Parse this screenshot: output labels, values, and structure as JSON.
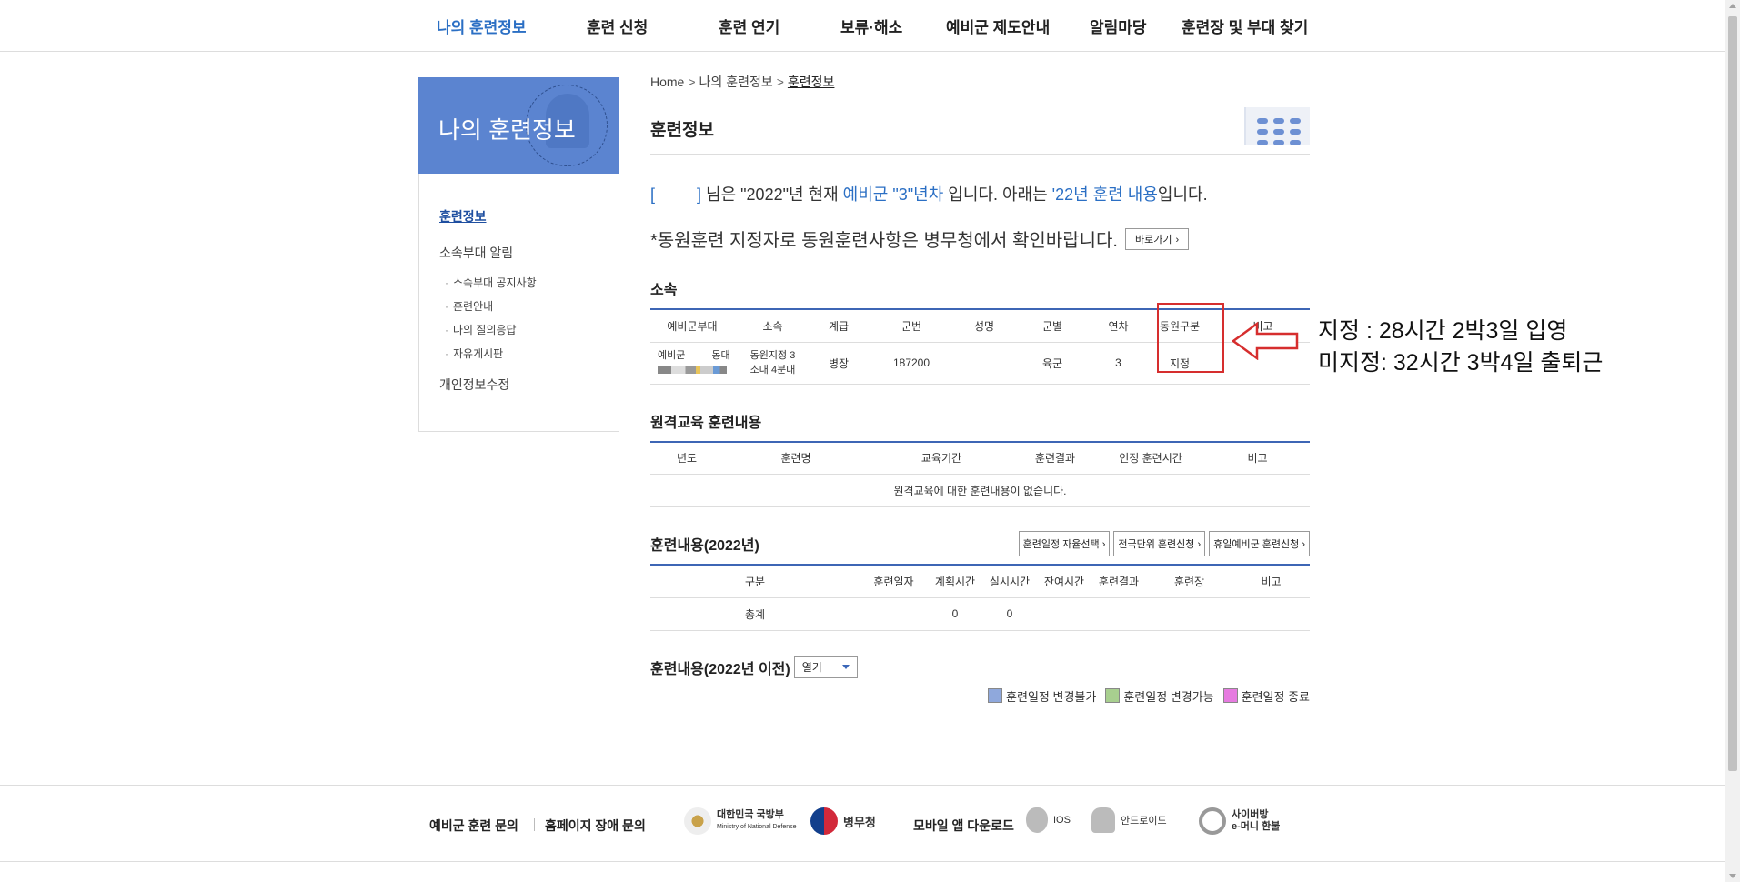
{
  "gnb": {
    "items": [
      "나의 훈련정보",
      "훈련 신청",
      "훈련 연기",
      "보류·해소",
      "예비군 제도안내",
      "알림마당",
      "훈련장 및 부대 찾기"
    ],
    "active_color": "#2b6fc4"
  },
  "lnb": {
    "title": "나의 훈련정보",
    "menu": {
      "training_info": "훈련정보",
      "unit_notice": "소속부대 알림",
      "sub": [
        "소속부대 공지사항",
        "훈련안내",
        "나의 질의응답",
        "자유게시판"
      ],
      "profile_edit": "개인정보수정"
    },
    "head_color": "#5b84d0"
  },
  "breadcrumb": {
    "home": "Home",
    "level1": "나의 훈련정보",
    "current": "훈련정보"
  },
  "page_title": "훈련정보",
  "intro": {
    "bracket_open": "[",
    "bracket_close": "]",
    "part1": " 님은 \"2022\"년 현재 ",
    "reserve": "예비군 \"3\"년차",
    "part2": " 입니다. 아래는 ",
    "year_training": "'22년 훈련 내용",
    "part3": "입니다."
  },
  "notice": {
    "text": "*동원훈련 지정자로 동원훈련사항은 병무청에서 확인바랍니다.",
    "button": "바로가기",
    "button_chevron": "›"
  },
  "affiliation": {
    "title": "소속",
    "headers": [
      "예비군부대",
      "소속",
      "계급",
      "군번",
      "성명",
      "군별",
      "연차",
      "동원구분",
      "비고"
    ],
    "row": {
      "unit_line1": "예비군",
      "unit_line2": "동대",
      "affil_line1": "동원지정 3",
      "affil_line2": "소대 4분대",
      "rank": "병장",
      "service_no": "187200",
      "name": "",
      "branch": "육군",
      "year": "3",
      "mobilization": "지정",
      "note": ""
    }
  },
  "annotation": {
    "line1": "지정 : 28시간 2박3일 입영",
    "line2": "미지정: 32시간 3박4일 출퇴근"
  },
  "remote": {
    "title": "원격교육 훈련내용",
    "headers": [
      "년도",
      "훈련명",
      "교육기간",
      "훈련결과",
      "인정 훈련시간",
      "비고"
    ],
    "empty_message": "원격교육에 대한 훈련내용이 없습니다."
  },
  "training": {
    "title": "훈련내용(2022년)",
    "buttons": [
      "훈련일정 자율선택 ›",
      "전국단위 훈련신청 ›",
      "휴일예비군 훈련신청 ›"
    ],
    "headers": [
      "구분",
      "훈련일자",
      "계획시간",
      "실시시간",
      "잔여시간",
      "훈련결과",
      "훈련장",
      "비고"
    ],
    "total_row": {
      "label": "총계",
      "date": "",
      "planned": "0",
      "actual": "0",
      "remaining": "",
      "result": "",
      "place": "",
      "note": ""
    }
  },
  "old_training": {
    "title": "훈련내용(2022년 이전)",
    "select": "열기"
  },
  "legend": [
    {
      "label": "훈련일정 변경불가",
      "color": "#8fa8dc"
    },
    {
      "label": "훈련일정 변경가능",
      "color": "#a8cf8f"
    },
    {
      "label": "훈련일정 종료",
      "color": "#e67be0"
    }
  ],
  "footer": {
    "links": [
      "예비군 훈련 문의",
      "홈페이지 장애 문의"
    ],
    "mnd_ko": "대한민국 국방부",
    "mnd_en": "Ministry of National Defense",
    "mma": "병무청",
    "mobile": "모바일 앱 다운로드",
    "ios": "IOS",
    "android": "안드로이드",
    "cyber_line1": "사이버방",
    "cyber_line2": "e-머니 환불"
  }
}
